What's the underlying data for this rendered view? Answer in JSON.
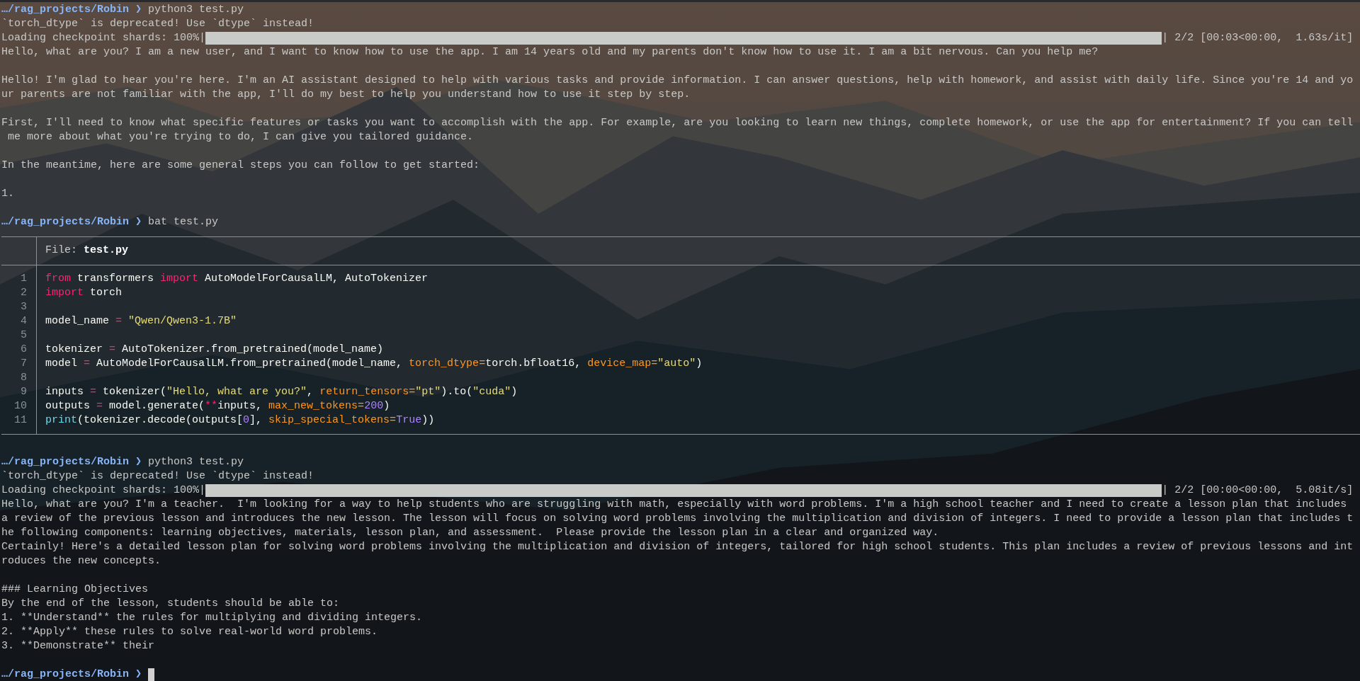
{
  "terminal": {
    "lines": [
      {
        "kind": "prompt",
        "path": "…/rag_projects/Robin",
        "symbol": "❯",
        "command": "python3 test.py"
      },
      {
        "kind": "text",
        "text": "`torch_dtype` is deprecated! Use `dtype` instead!"
      },
      {
        "kind": "progress",
        "label": "Loading checkpoint shards: 100%|",
        "level": 1,
        "stats": "| 2/2 [00:03<00:00,  1.63s/it]"
      },
      {
        "kind": "text",
        "text": "Hello, what are you? I am a new user, and I want to know how to use the app. I am 14 years old and my parents don't know how to use it. I am a bit nervous. Can you help me?"
      },
      {
        "kind": "blank"
      },
      {
        "kind": "text",
        "text": "Hello! I'm glad to hear you're here. I'm an AI assistant designed to help with various tasks and provide information. I can answer questions, help with homework, and assist with daily life. Since you're 14 and yo"
      },
      {
        "kind": "text",
        "text": "ur parents are not familiar with the app, I'll do my best to help you understand how to use it step by step."
      },
      {
        "kind": "blank"
      },
      {
        "kind": "text",
        "text": "First, I'll need to know what specific features or tasks you want to accomplish with the app. For example, are you looking to learn new things, complete homework, or use the app for entertainment? If you can tell"
      },
      {
        "kind": "text",
        "text": " me more about what you're trying to do, I can give you tailored guidance."
      },
      {
        "kind": "blank"
      },
      {
        "kind": "text",
        "text": "In the meantime, here are some general steps you can follow to get started:"
      },
      {
        "kind": "blank"
      },
      {
        "kind": "text",
        "text": "1."
      },
      {
        "kind": "blank"
      },
      {
        "kind": "prompt",
        "path": "…/rag_projects/Robin",
        "symbol": "❯",
        "command": "bat test.py"
      },
      {
        "kind": "file",
        "header": "File: **test.py**",
        "code": [
          {
            "number": "1",
            "tokens": [
              {
                "text": "from",
                "kind": "keyword"
              },
              {
                "text": " transformers ",
                "kind": "plain"
              },
              {
                "text": "import",
                "kind": "keyword"
              },
              {
                "text": " AutoModelForCausalLM, AutoTokenizer",
                "kind": "plain"
              }
            ]
          },
          {
            "number": "2",
            "tokens": [
              {
                "text": "import",
                "kind": "keyword"
              },
              {
                "text": " torch",
                "kind": "plain"
              }
            ]
          },
          {
            "number": "3"
          },
          {
            "number": "4",
            "tokens": [
              {
                "text": "model_name ",
                "kind": "plain"
              },
              {
                "text": "= ",
                "kind": "keyword"
              },
              {
                "text": "\"Qwen/Qwen3-1.7B\"",
                "kind": "string"
              }
            ]
          },
          {
            "number": "5"
          },
          {
            "number": "6",
            "tokens": [
              {
                "text": "tokenizer ",
                "kind": "plain"
              },
              {
                "text": "=",
                "kind": "keyword"
              },
              {
                "text": " AutoTokenizer.from_pretrained(model_name)",
                "kind": "plain"
              }
            ]
          },
          {
            "number": "7",
            "tokens": [
              {
                "text": "model ",
                "kind": "plain"
              },
              {
                "text": "=",
                "kind": "keyword"
              },
              {
                "text": " AutoModelForCausalLM.from_pretrained(model_name, ",
                "kind": "plain"
              },
              {
                "text": "torch_dtype=",
                "kind": "param"
              },
              {
                "text": "torch.bfloat16, ",
                "kind": "plain"
              },
              {
                "text": "device_map=",
                "kind": "param"
              },
              {
                "text": "\"auto\"",
                "kind": "string"
              },
              {
                "text": ")",
                "kind": "plain"
              }
            ]
          },
          {
            "number": "8"
          },
          {
            "number": "9",
            "tokens": [
              {
                "text": "inputs ",
                "kind": "plain"
              },
              {
                "text": "=",
                "kind": "keyword"
              },
              {
                "text": " tokenizer(",
                "kind": "plain"
              },
              {
                "text": "\"Hello, what are you?\"",
                "kind": "string"
              },
              {
                "text": ", ",
                "kind": "plain"
              },
              {
                "text": "return_tensors=",
                "kind": "param"
              },
              {
                "text": "\"pt\"",
                "kind": "string"
              },
              {
                "text": ").to(",
                "kind": "plain"
              },
              {
                "text": "\"cuda\"",
                "kind": "string"
              },
              {
                "text": ")",
                "kind": "plain"
              }
            ]
          },
          {
            "number": "10",
            "tokens": [
              {
                "text": "outputs ",
                "kind": "plain"
              },
              {
                "text": "=",
                "kind": "keyword"
              },
              {
                "text": " model.generate(",
                "kind": "plain"
              },
              {
                "text": "**",
                "kind": "keyword"
              },
              {
                "text": "inputs, ",
                "kind": "plain"
              },
              {
                "text": "max_new_tokens=",
                "kind": "param"
              },
              {
                "text": "200",
                "kind": "number"
              },
              {
                "text": ")",
                "kind": "plain"
              }
            ]
          },
          {
            "number": "11",
            "tokens": [
              {
                "text": "print",
                "kind": "builtin"
              },
              {
                "text": "(tokenizer.decode(outputs[",
                "kind": "plain"
              },
              {
                "text": "0",
                "kind": "number"
              },
              {
                "text": "], ",
                "kind": "plain"
              },
              {
                "text": "skip_special_tokens=",
                "kind": "param"
              },
              {
                "text": "True",
                "kind": "number"
              },
              {
                "text": "))",
                "kind": "plain"
              }
            ]
          }
        ]
      },
      {
        "kind": "blank"
      },
      {
        "kind": "prompt",
        "path": "…/rag_projects/Robin",
        "symbol": "❯",
        "command": "python3 test.py"
      },
      {
        "kind": "text",
        "text": "`torch_dtype` is deprecated! Use `dtype` instead!"
      },
      {
        "kind": "progress",
        "label": "Loading checkpoint shards: 100%|",
        "level": 1,
        "stats": "| 2/2 [00:00<00:00,  5.08it/s]"
      },
      {
        "kind": "text",
        "text": "Hello, what are you? I'm a teacher.  I'm looking for a way to help students who are struggling with math, especially with word problems. I'm a high school teacher and I need to create a lesson plan that includes"
      },
      {
        "kind": "text",
        "text": "a review of the previous lesson and introduces the new lesson. The lesson will focus on solving word problems involving the multiplication and division of integers. I need to provide a lesson plan that includes t"
      },
      {
        "kind": "text",
        "text": "he following components: learning objectives, materials, lesson plan, and assessment.  Please provide the lesson plan in a clear and organized way."
      },
      {
        "kind": "text",
        "text": "Certainly! Here's a detailed lesson plan for solving word problems involving the multiplication and division of integers, tailored for high school students. This plan includes a review of previous lessons and int"
      },
      {
        "kind": "text",
        "text": "roduces the new concepts."
      },
      {
        "kind": "blank"
      },
      {
        "kind": "text",
        "text": "### Learning Objectives"
      },
      {
        "kind": "text",
        "text": "By the end of the lesson, students should be able to:"
      },
      {
        "kind": "text",
        "text": "1. **Understand** the rules for multiplying and dividing integers."
      },
      {
        "kind": "text",
        "text": "2. **Apply** these rules to solve real-world word problems."
      },
      {
        "kind": "text",
        "text": "3. **Demonstrate** their"
      },
      {
        "kind": "blank"
      },
      {
        "kind": "prompt",
        "path": "…/rag_projects/Robin",
        "symbol": "❯",
        "cursor": true
      }
    ]
  }
}
